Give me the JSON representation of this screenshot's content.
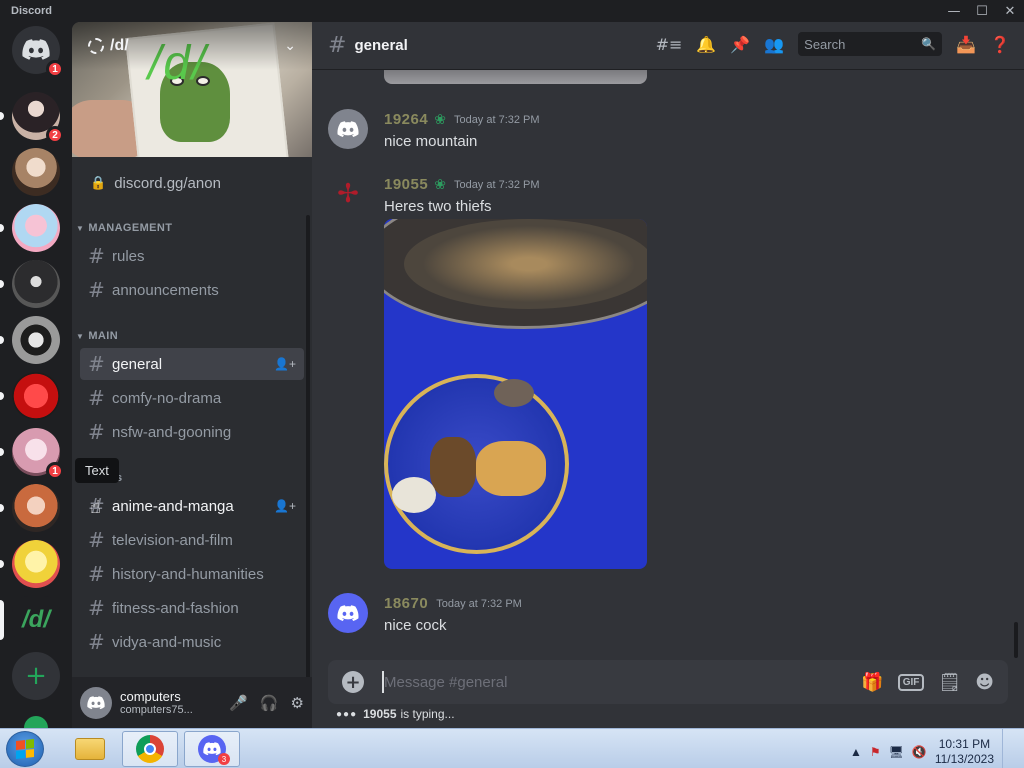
{
  "window": {
    "app_name": "Discord",
    "controls": [
      "minimize-icon",
      "maximize-icon",
      "close-icon"
    ]
  },
  "servers": [
    {
      "name": "home",
      "badge": "1"
    },
    {
      "name": "server-2",
      "badge": "2"
    },
    {
      "name": "server-3",
      "badge": ""
    },
    {
      "name": "server-4",
      "badge": ""
    },
    {
      "name": "server-5",
      "badge": ""
    },
    {
      "name": "server-6",
      "badge": ""
    },
    {
      "name": "server-7",
      "badge": ""
    },
    {
      "name": "server-8",
      "badge": "1"
    },
    {
      "name": "server-9",
      "badge": ""
    },
    {
      "name": "server-10",
      "badge": ""
    },
    {
      "name": "server-d",
      "label": "/d/"
    }
  ],
  "sidebar": {
    "server_name": "/d/",
    "banner_text": "/d/",
    "invite": "discord.gg/anon",
    "categories": {
      "management": "MANAGEMENT",
      "main": "MAIN",
      "text_visible": "s"
    },
    "channels": {
      "rules": "rules",
      "announcements": "announcements",
      "general": "general",
      "comfy": "comfy-no-drama",
      "nsfw": "nsfw-and-gooning",
      "anime": "anime-and-manga",
      "tv": "television-and-film",
      "history": "history-and-humanities",
      "fitness": "fitness-and-fashion",
      "vidya": "vidya-and-music"
    },
    "tooltip": "Text"
  },
  "user": {
    "name": "computers",
    "tag": "computers75..."
  },
  "chat": {
    "channel": "general",
    "search_placeholder": "Search",
    "messages": [
      {
        "author": "19264",
        "time": "Today at 7:32 PM",
        "text": "nice mountain"
      },
      {
        "author": "19055",
        "time": "Today at 7:32 PM",
        "text": "Heres two thiefs"
      },
      {
        "author": "18670",
        "time": "Today at 7:32 PM",
        "text": "nice cock"
      }
    ],
    "composer_placeholder": "Message #general",
    "typing_user": "19055",
    "typing_suffix": "is typing..."
  },
  "taskbar": {
    "time": "10:31 PM",
    "date": "11/13/2023",
    "discord_badge": "3"
  },
  "colors": {
    "accent": "#5865f2",
    "author_color": "#8a8a5e",
    "danger": "#f23f43",
    "online_green": "#23a55a"
  }
}
